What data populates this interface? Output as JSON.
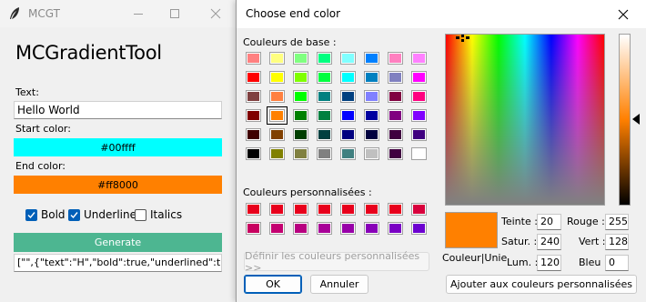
{
  "app": {
    "window_title": "MCGT",
    "heading": "MCGradientTool",
    "text_label": "Text:",
    "text_value": "Hello World",
    "start_label": "Start color:",
    "start_value": "#00ffff",
    "start_color": "#00ffff",
    "end_label": "End color:",
    "end_value": "#ff8000",
    "end_color": "#ff8000",
    "options": [
      {
        "label": "Bold",
        "checked": true
      },
      {
        "label": "Underline",
        "checked": true
      },
      {
        "label": "Italics",
        "checked": false
      }
    ],
    "generate_label": "Generate",
    "generate_color": "#4db691",
    "output_value": "[\"\",{\"text\":\"H\",\"bold\":true,\"underlined\":true"
  },
  "dialog": {
    "title": "Choose end color",
    "basic_colors_label": "Couleurs de base :",
    "basic_colors": [
      "#ff8080",
      "#ffff80",
      "#80ff80",
      "#00ff80",
      "#80ffff",
      "#0080ff",
      "#ff80c0",
      "#ff80ff",
      "#ff0000",
      "#ffff00",
      "#80ff00",
      "#00ff40",
      "#00ffff",
      "#0080c0",
      "#8080c0",
      "#ff00ff",
      "#804040",
      "#ff8040",
      "#00ff00",
      "#008080",
      "#004080",
      "#8080ff",
      "#800040",
      "#ff0080",
      "#800000",
      "#ff8000",
      "#008000",
      "#008040",
      "#0000ff",
      "#0000a0",
      "#800080",
      "#8000ff",
      "#400000",
      "#804000",
      "#004000",
      "#004040",
      "#000080",
      "#000040",
      "#400040",
      "#400080",
      "#000000",
      "#808000",
      "#808040",
      "#808080",
      "#408080",
      "#c0c0c0",
      "#400040",
      "#ffffff"
    ],
    "selected_basic_index": 25,
    "custom_colors_label": "Couleurs personnalisées :",
    "custom_colors": [
      "#e8001c",
      "#e8001c",
      "#e8001c",
      "#e8001c",
      "#e8001c",
      "#e8001c",
      "#e8001c",
      "#d8003c",
      "#c80060",
      "#c40070",
      "#b80080",
      "#a80098",
      "#9800a8",
      "#8800b8",
      "#7a00c4",
      "#6c00d0"
    ],
    "define_custom_label": "Définir les couleurs personnalisées >>",
    "ok_label": "OK",
    "cancel_label": "Annuler",
    "preview_label": "Couleur|Unie",
    "preview_color": "#ff8000",
    "hue_label": "Teinte :",
    "hue_value": "20",
    "sat_label": "Satur. :",
    "sat_value": "240",
    "lum_label": "Lum. :",
    "lum_value": "120",
    "red_label": "Rouge :",
    "red_value": "255",
    "green_label": "Vert :",
    "green_value": "128",
    "blue_label": "Bleu :",
    "blue_value": "0",
    "add_custom_label": "Ajouter aux couleurs personnalisées"
  }
}
